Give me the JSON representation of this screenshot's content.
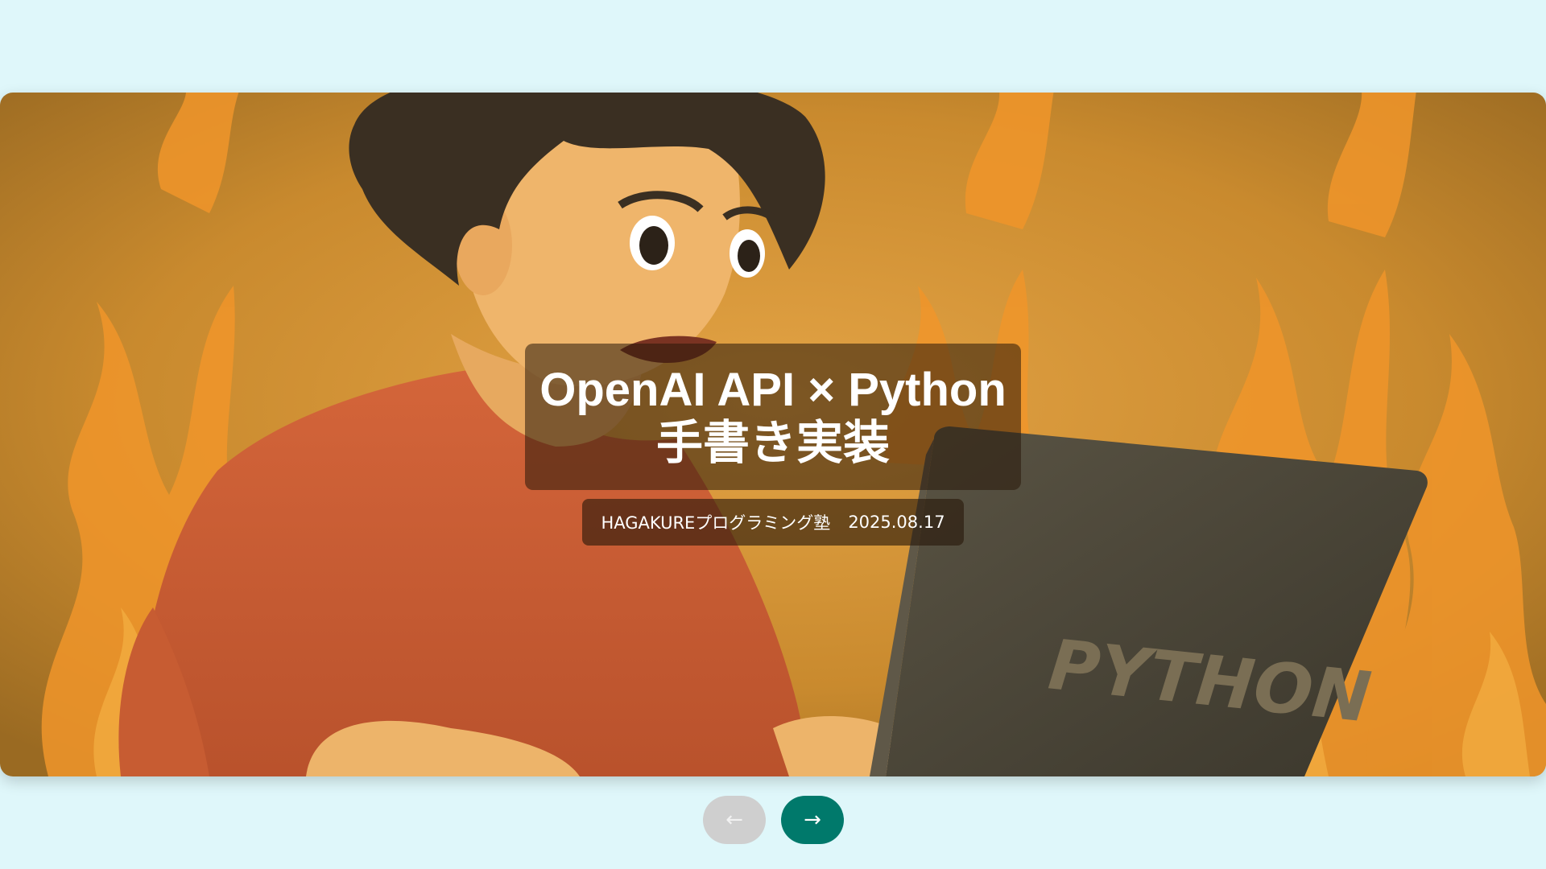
{
  "slide": {
    "title_line1": "OpenAI API × Python",
    "title_line2": "手書き実装",
    "author": "HAGAKUREプログラミング塾",
    "date": "2025.08.17",
    "art_text": "PYTHON"
  },
  "nav": {
    "prev_icon": "←",
    "next_icon": "→",
    "prev_state": "disabled"
  },
  "colors": {
    "page_background": "#dff7fa",
    "next_button": "#00796b",
    "prev_button": "#cfcfcf"
  }
}
